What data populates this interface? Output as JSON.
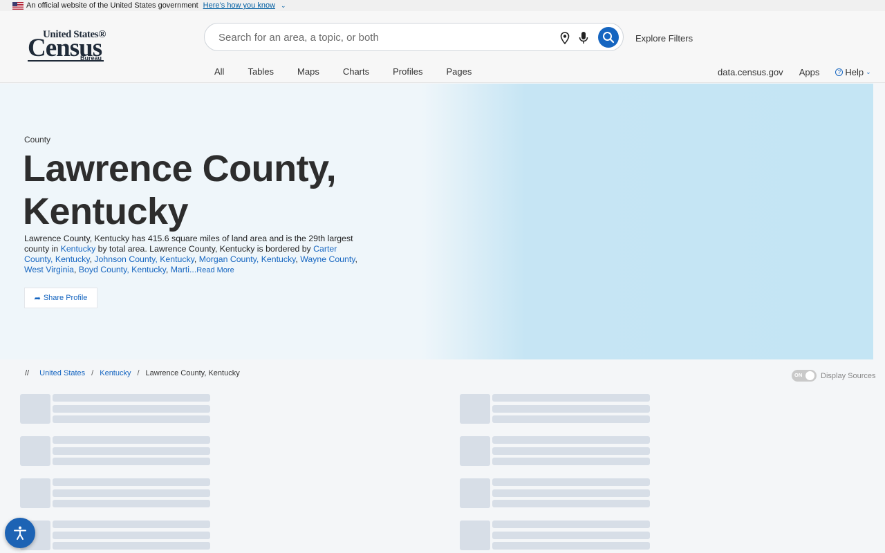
{
  "gov_banner": {
    "text": "An official website of the United States government",
    "link": "Here’s how you know"
  },
  "logo": {
    "line1": "United States®",
    "line2": "Census",
    "line3": "Bureau"
  },
  "search": {
    "placeholder": "Search for an area, a topic, or both",
    "value": ""
  },
  "header": {
    "explore_filters": "Explore Filters",
    "nav": [
      "All",
      "Tables",
      "Maps",
      "Charts",
      "Profiles",
      "Pages"
    ],
    "right_nav": {
      "data_link": "data.census.gov",
      "apps": "Apps",
      "help": "Help"
    }
  },
  "hero": {
    "type": "County",
    "title": "Lawrence County, Kentucky",
    "desc_1": "Lawrence County, Kentucky has 415.6 square miles of land area and is the 29th largest county in ",
    "desc_kentucky": "Kentucky",
    "desc_2": " by total area. Lawrence County, Kentucky is bordered by ",
    "neighbors": [
      "Carter County, Kentucky",
      "Johnson County, Kentucky",
      "Morgan County, Kentucky",
      "Wayne County",
      "West Virginia",
      "Boyd County, Kentucky"
    ],
    "truncated": "Marti...",
    "read_more": "Read More",
    "share": "Share Profile"
  },
  "breadcrumb": {
    "lead": "//",
    "items": [
      "United States",
      "Kentucky",
      "Lawrence County, Kentucky"
    ]
  },
  "toggle": {
    "state": "ON",
    "label": "Display Sources"
  }
}
